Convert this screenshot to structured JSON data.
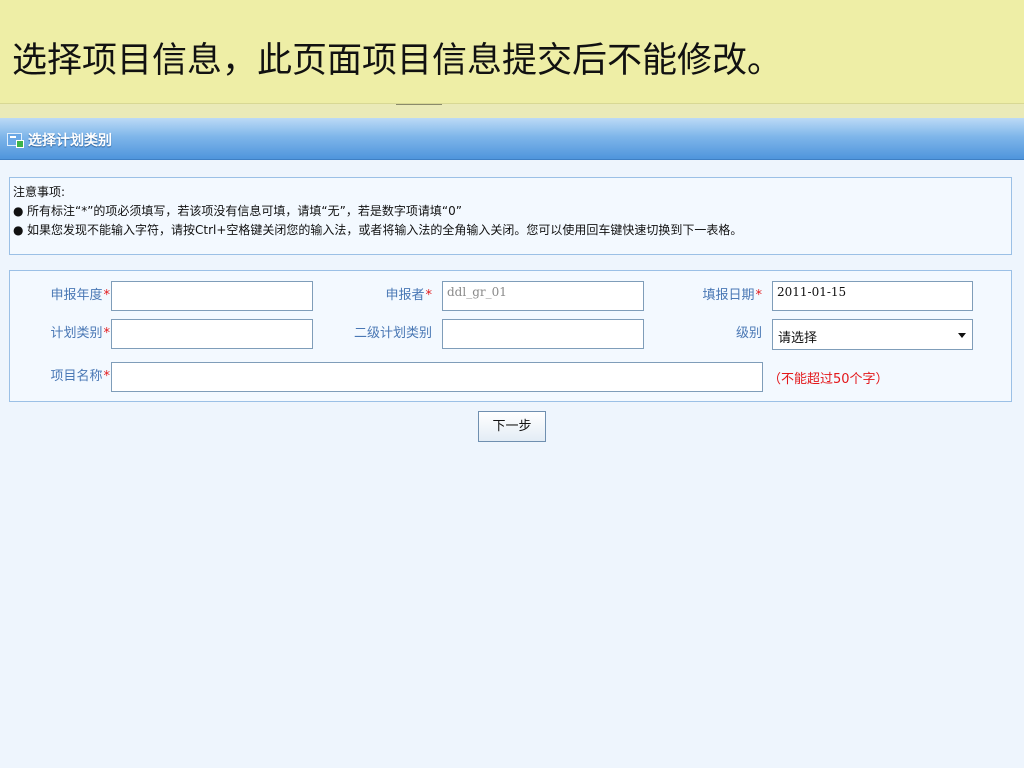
{
  "slide": {
    "caption": "选择项目信息，此页面项目信息提交后不能修改。"
  },
  "window": {
    "title": "选择计划类别",
    "icon": "form-icon"
  },
  "notice": {
    "heading": "注意事项:",
    "bullet": "●",
    "items": [
      "所有标注“*”的项必须填写，若该项没有信息可填，请填“无”，若是数字项请填“0”",
      "如果您发现不能输入字符，请按Ctrl+空格键关闭您的输入法，或者将输入法的全角输入关闭。您可以使用回车键快速切换到下一表格。"
    ]
  },
  "form": {
    "required_mark": "*",
    "fields": {
      "report_year": {
        "label": "申报年度",
        "value": ""
      },
      "applicant": {
        "label": "申报者",
        "value": "ddl_gr_01"
      },
      "fill_date": {
        "label": "填报日期",
        "value": "2011-01-15"
      },
      "plan_category": {
        "label": "计划类别",
        "value": ""
      },
      "sub_plan_category": {
        "label": "二级计划类别",
        "value": ""
      },
      "level": {
        "label": "级别",
        "value": "请选择"
      },
      "project_name": {
        "label": "项目名称",
        "value": "",
        "hint": "（不能超过50个字）"
      }
    }
  },
  "buttons": {
    "next": "下一步"
  },
  "colors": {
    "banner": "#eeeea6",
    "titlebar": "#4f95dc",
    "label": "#4a78b5",
    "required": "#e3171a",
    "page": "#eef5fd"
  }
}
